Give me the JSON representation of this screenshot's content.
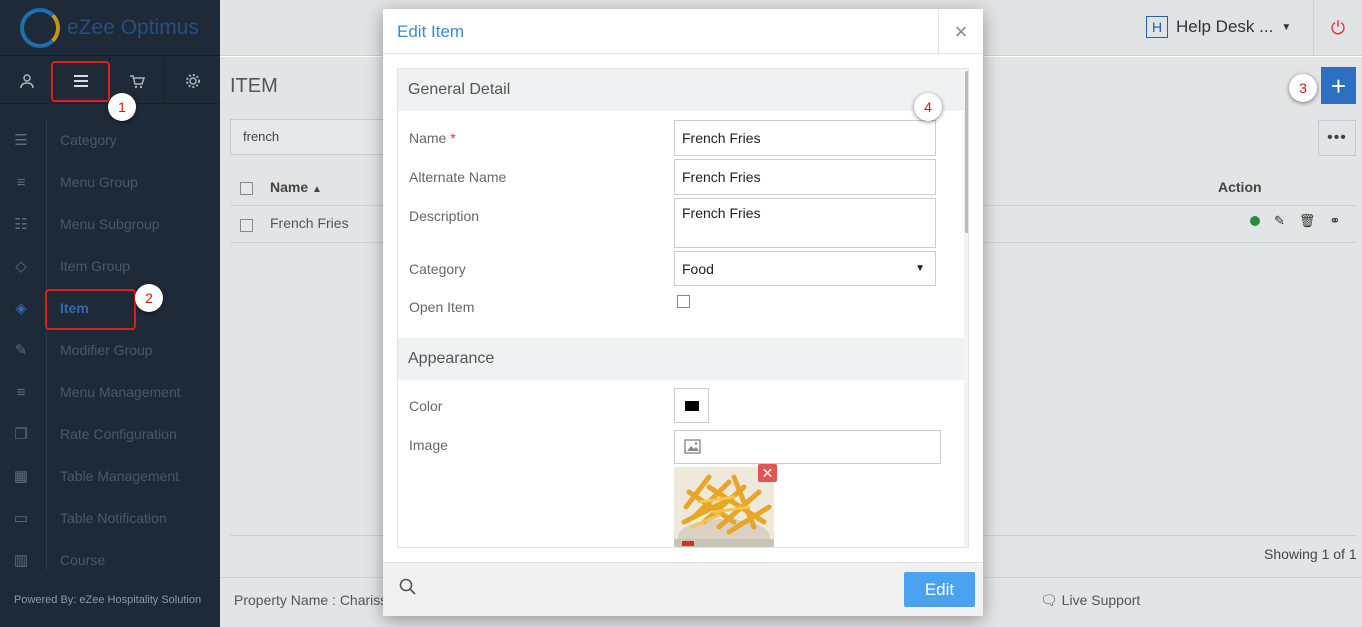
{
  "sidebar": {
    "logo_text": "eZee Optimus",
    "tabs": [
      "user-icon",
      "menu-icon",
      "cart-icon",
      "gear-icon"
    ],
    "items": [
      {
        "label": "Category",
        "icon": "category-icon"
      },
      {
        "label": "Menu Group",
        "icon": "list-icon"
      },
      {
        "label": "Menu Subgroup",
        "icon": "sublist-icon"
      },
      {
        "label": "Item Group",
        "icon": "box-icon"
      },
      {
        "label": "Item",
        "icon": "cube-icon"
      },
      {
        "label": "Modifier Group",
        "icon": "edit-icon"
      },
      {
        "label": "Menu Management",
        "icon": "lines-icon"
      },
      {
        "label": "Rate Configuration",
        "icon": "copy-icon"
      },
      {
        "label": "Table Management",
        "icon": "grid-icon"
      },
      {
        "label": "Table Notification",
        "icon": "chat-icon"
      },
      {
        "label": "Course",
        "icon": "course-icon"
      }
    ],
    "powered": "Powered By: eZee Hospitality Solution"
  },
  "topbar": {
    "help_letter": "H",
    "help_label": "Help Desk ..."
  },
  "page": {
    "title": "ITEM",
    "search_value": "french",
    "col_name": "Name",
    "col_action": "Action",
    "rows": [
      {
        "name": "French Fries"
      }
    ],
    "showing": "Showing 1 of 1",
    "property": "Property Name : Chariss",
    "live_support": "Live Support"
  },
  "callouts": [
    "1",
    "2",
    "3",
    "4"
  ],
  "modal": {
    "title": "Edit Item",
    "section_general": "General Detail",
    "name_label": "Name",
    "name_value": "French Fries",
    "alt_label": "Alternate Name",
    "alt_value": "French Fries",
    "desc_label": "Description",
    "desc_value": "French Fries",
    "category_label": "Category",
    "category_value": "Food",
    "open_label": "Open Item",
    "section_appearance": "Appearance",
    "color_label": "Color",
    "color_value": "#000000",
    "image_label": "Image",
    "edit_button": "Edit"
  }
}
